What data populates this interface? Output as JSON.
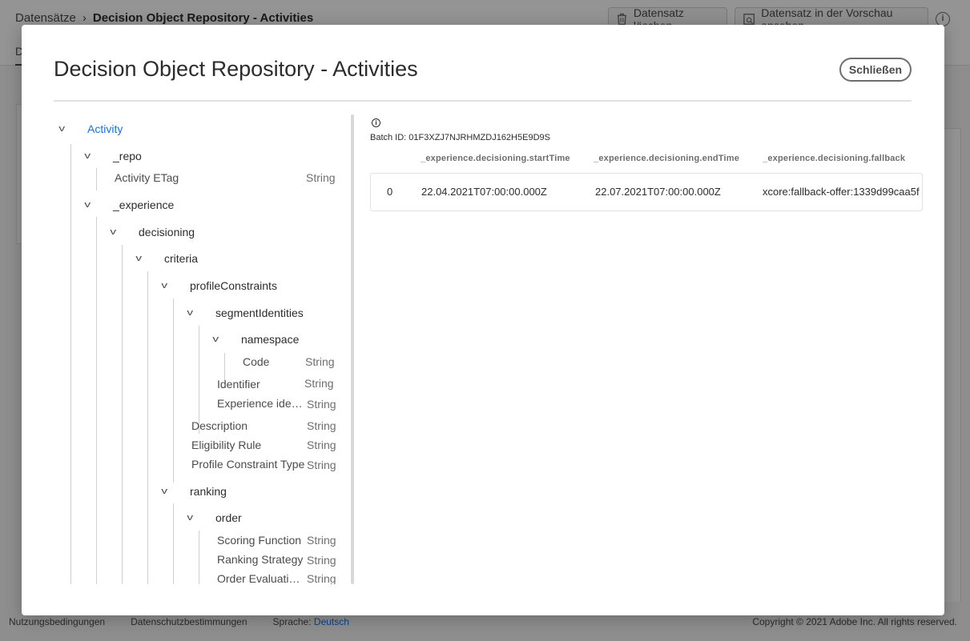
{
  "background": {
    "breadcrumb": {
      "parent": "Datensätze",
      "separator": "›",
      "current": "Decision Object Repository - Activities"
    },
    "buttons": {
      "delete": "Datensatz löschen",
      "preview": "Datensatz in der Vorschau ansehen"
    },
    "tab_initial": "D",
    "footer": {
      "terms": "Nutzungsbedingungen",
      "privacy": "Datenschutzbestimmungen",
      "language_label": "Sprache:",
      "language_value": "Deutsch",
      "copyright": "Copyright ©  2021 Adobe Inc.  All rights reserved."
    }
  },
  "modal": {
    "title": "Decision Object Repository - Activities",
    "close_label": "Schließen",
    "tree": {
      "root": "Activity",
      "repo": "_repo",
      "activity_etag": "Activity ETag",
      "experience": "_experience",
      "decisioning": "decisioning",
      "criteria": "criteria",
      "profile_constraints": "profileConstraints",
      "segment_identities": "segmentIdentities",
      "namespace": "namespace",
      "code": "Code",
      "identifier": "Identifier",
      "experience_identifier": "Experience identi…",
      "description": "Description",
      "eligibility_rule": "Eligibility Rule",
      "profile_constraint_type": "Profile Constraint Type",
      "ranking": "ranking",
      "order": "order",
      "scoring_function": "Scoring Function",
      "ranking_strategy": "Ranking Strategy",
      "order_evaluation": "Order Evaluation …",
      "type_string": "String"
    },
    "data": {
      "info_glyph": "i",
      "batch_id": "Batch ID: 01F3XZJ7NJRHMZDJ162H5E9D9S",
      "columns": [
        "_experience.decisioning.startTime",
        "_experience.decisioning.endTime",
        "_experience.decisioning.fallback"
      ],
      "row": {
        "index": "0",
        "start": "22.04.2021T07:00:00.000Z",
        "end": "22.07.2021T07:00:00.000Z",
        "fallback": "xcore:fallback-offer:1339d99caa5f"
      }
    }
  }
}
